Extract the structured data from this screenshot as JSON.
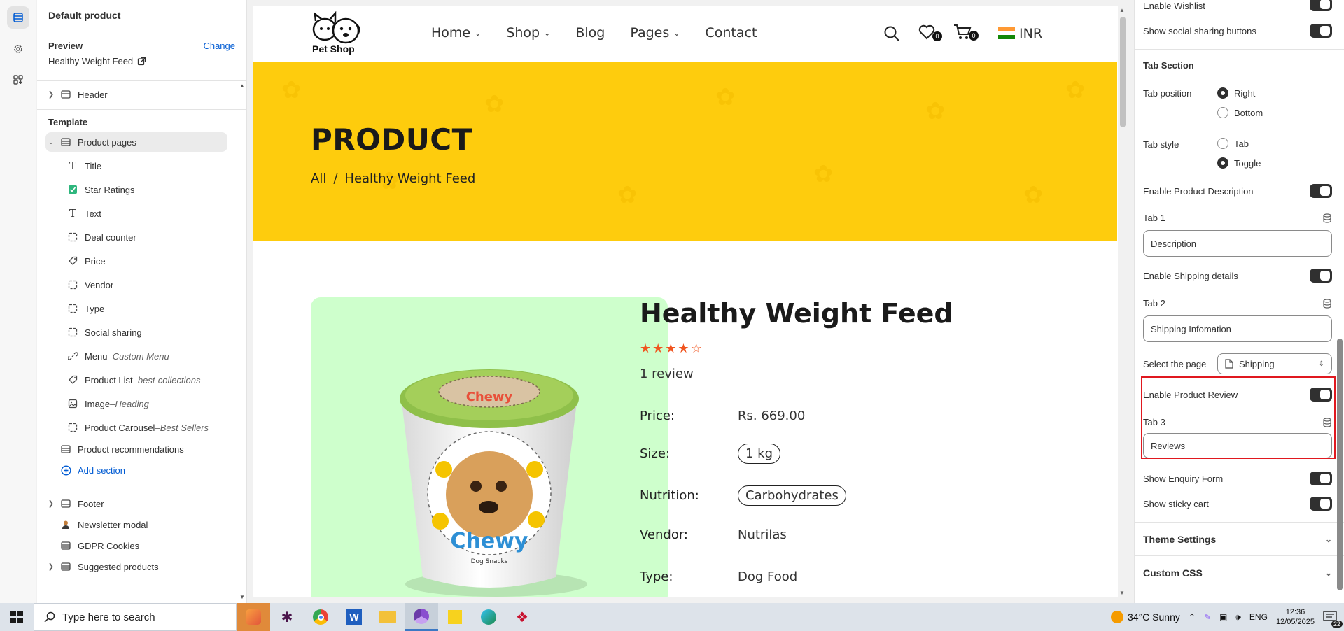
{
  "sidebar": {
    "title": "Default product",
    "preview_label": "Preview",
    "change_label": "Change",
    "preview_value": "Healthy Weight Feed",
    "header_label": "Header",
    "template_label": "Template",
    "product_pages_label": "Product pages",
    "blocks": [
      {
        "label": "Title",
        "suffix": ""
      },
      {
        "label": "Star Ratings",
        "suffix": ""
      },
      {
        "label": "Text",
        "suffix": ""
      },
      {
        "label": "Deal counter",
        "suffix": ""
      },
      {
        "label": "Price",
        "suffix": ""
      },
      {
        "label": "Vendor",
        "suffix": ""
      },
      {
        "label": "Type",
        "suffix": ""
      },
      {
        "label": "Social sharing",
        "suffix": ""
      },
      {
        "label": "Menu",
        "suffix": "Custom Menu"
      },
      {
        "label": "Product List",
        "suffix": "best-collections"
      },
      {
        "label": "Image",
        "suffix": "Heading"
      },
      {
        "label": "Product Carousel",
        "suffix": "Best Sellers"
      }
    ],
    "product_recommendations_label": "Product recommendations",
    "add_section_label": "Add section",
    "footer_label": "Footer",
    "newsletter_label": "Newsletter modal",
    "gdpr_label": "GDPR Cookies",
    "suggested_label": "Suggested products",
    "separator": " – "
  },
  "store": {
    "logo_text": "Pet Shop",
    "nav": [
      {
        "label": "Home",
        "dropdown": true
      },
      {
        "label": "Shop",
        "dropdown": true
      },
      {
        "label": "Blog",
        "dropdown": false
      },
      {
        "label": "Pages",
        "dropdown": true
      },
      {
        "label": "Contact",
        "dropdown": false
      }
    ],
    "wishlist_count": "0",
    "cart_count": "0",
    "currency": "INR",
    "banner_title": "PRODUCT",
    "breadcrumb_all": "All",
    "breadcrumb_sep": "/",
    "breadcrumb_current": "Healthy Weight Feed",
    "product_title": "Healthy Weight Feed",
    "rating": 4,
    "rating_max": 5,
    "review_count": "1 review",
    "specs": {
      "price_label": "Price:",
      "price_value": "Rs. 669.00",
      "size_label": "Size:",
      "size_value": "1 kg",
      "nutrition_label": "Nutrition:",
      "nutrition_value": "Carbohydrates",
      "vendor_label": "Vendor:",
      "vendor_value": "Nutrilas",
      "type_label": "Type:",
      "type_value": "Dog Food"
    },
    "image_brand": "Chewy",
    "image_sub": "Dog Snacks",
    "brand_colors": {
      "banner": "#fecc0d",
      "image_bg": "#ceffcc",
      "stars": "#f0541e"
    }
  },
  "settings": {
    "enable_wishlist": "Enable Wishlist",
    "show_social": "Show social sharing buttons",
    "tab_section": "Tab Section",
    "tab_position_label": "Tab position",
    "tab_position_options": [
      "Right",
      "Bottom"
    ],
    "tab_position_selected": "Right",
    "tab_style_label": "Tab style",
    "tab_style_options": [
      "Tab",
      "Toggle"
    ],
    "tab_style_selected": "Toggle",
    "enable_description": "Enable Product Description",
    "tab1_label": "Tab 1",
    "tab1_value": "Description",
    "enable_shipping": "Enable Shipping details",
    "tab2_label": "Tab 2",
    "tab2_value": "Shipping Infomation",
    "select_page_label": "Select the page",
    "select_page_value": "Shipping",
    "enable_review": "Enable Product Review",
    "tab3_label": "Tab 3",
    "tab3_value": "Reviews",
    "show_enquiry": "Show Enquiry Form",
    "show_sticky": "Show sticky cart",
    "theme_settings": "Theme Settings",
    "custom_css": "Custom CSS"
  },
  "taskbar": {
    "search_placeholder": "Type here to search",
    "weather": "34°C  Sunny",
    "lang": "ENG",
    "time": "12:36",
    "date": "12/05/2025",
    "notif_count": "22"
  }
}
